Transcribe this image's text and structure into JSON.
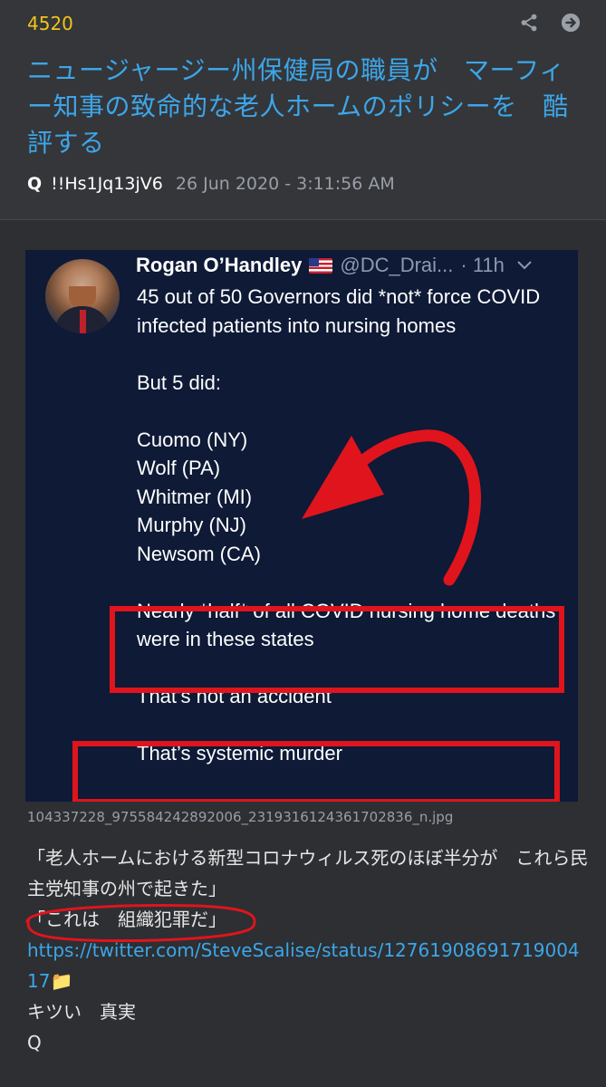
{
  "post": {
    "number": "4520",
    "title": "ニュージャージー州保健局の職員が　マーフィー知事の致命的な老人ホームのポリシーを　酷評する",
    "author": "Q",
    "tripcode": "!!Hs1Jq13jV6",
    "date": "26 Jun 2020 - 3:11:56 AM",
    "share_icon": "share-icon",
    "goto_icon": "arrow-right-circle-icon"
  },
  "tweet": {
    "name": "Rogan O’Handley",
    "handle": "@DC_Drai...",
    "time": "· 11h",
    "line1": "45 out of 50 Governors did *not* force COVID infected patients into nursing homes",
    "line2": "But 5 did:",
    "states": [
      "Cuomo (NY)",
      "Wolf (PA)",
      "Whitmer (MI)",
      "Murphy (NJ)",
      "Newsom (CA)"
    ],
    "highlight": "Nearly *half* of all COVID nursing home deaths were in these states",
    "line_accident": "That’s not an accident",
    "line_murder": "That’s systemic murder"
  },
  "attachment": {
    "filename": "104337228_975584242892006_2319316124361702836_n.jpg"
  },
  "body": {
    "quote1": "「老人ホームにおける新型コロナウィルス死のほぼ半分が　これら民主党知事の州で起きた」",
    "quote2": "「これは　組織犯罪だ」",
    "link": "https://twitter.com/SteveScalise/status/1276190869171900417",
    "folder_icon": "📁",
    "line3": "キツい　真実",
    "signature": "Q"
  },
  "colors": {
    "accent_yellow": "#f2c418",
    "link_blue": "#3da6e8",
    "highlight_red": "#e0141c"
  }
}
